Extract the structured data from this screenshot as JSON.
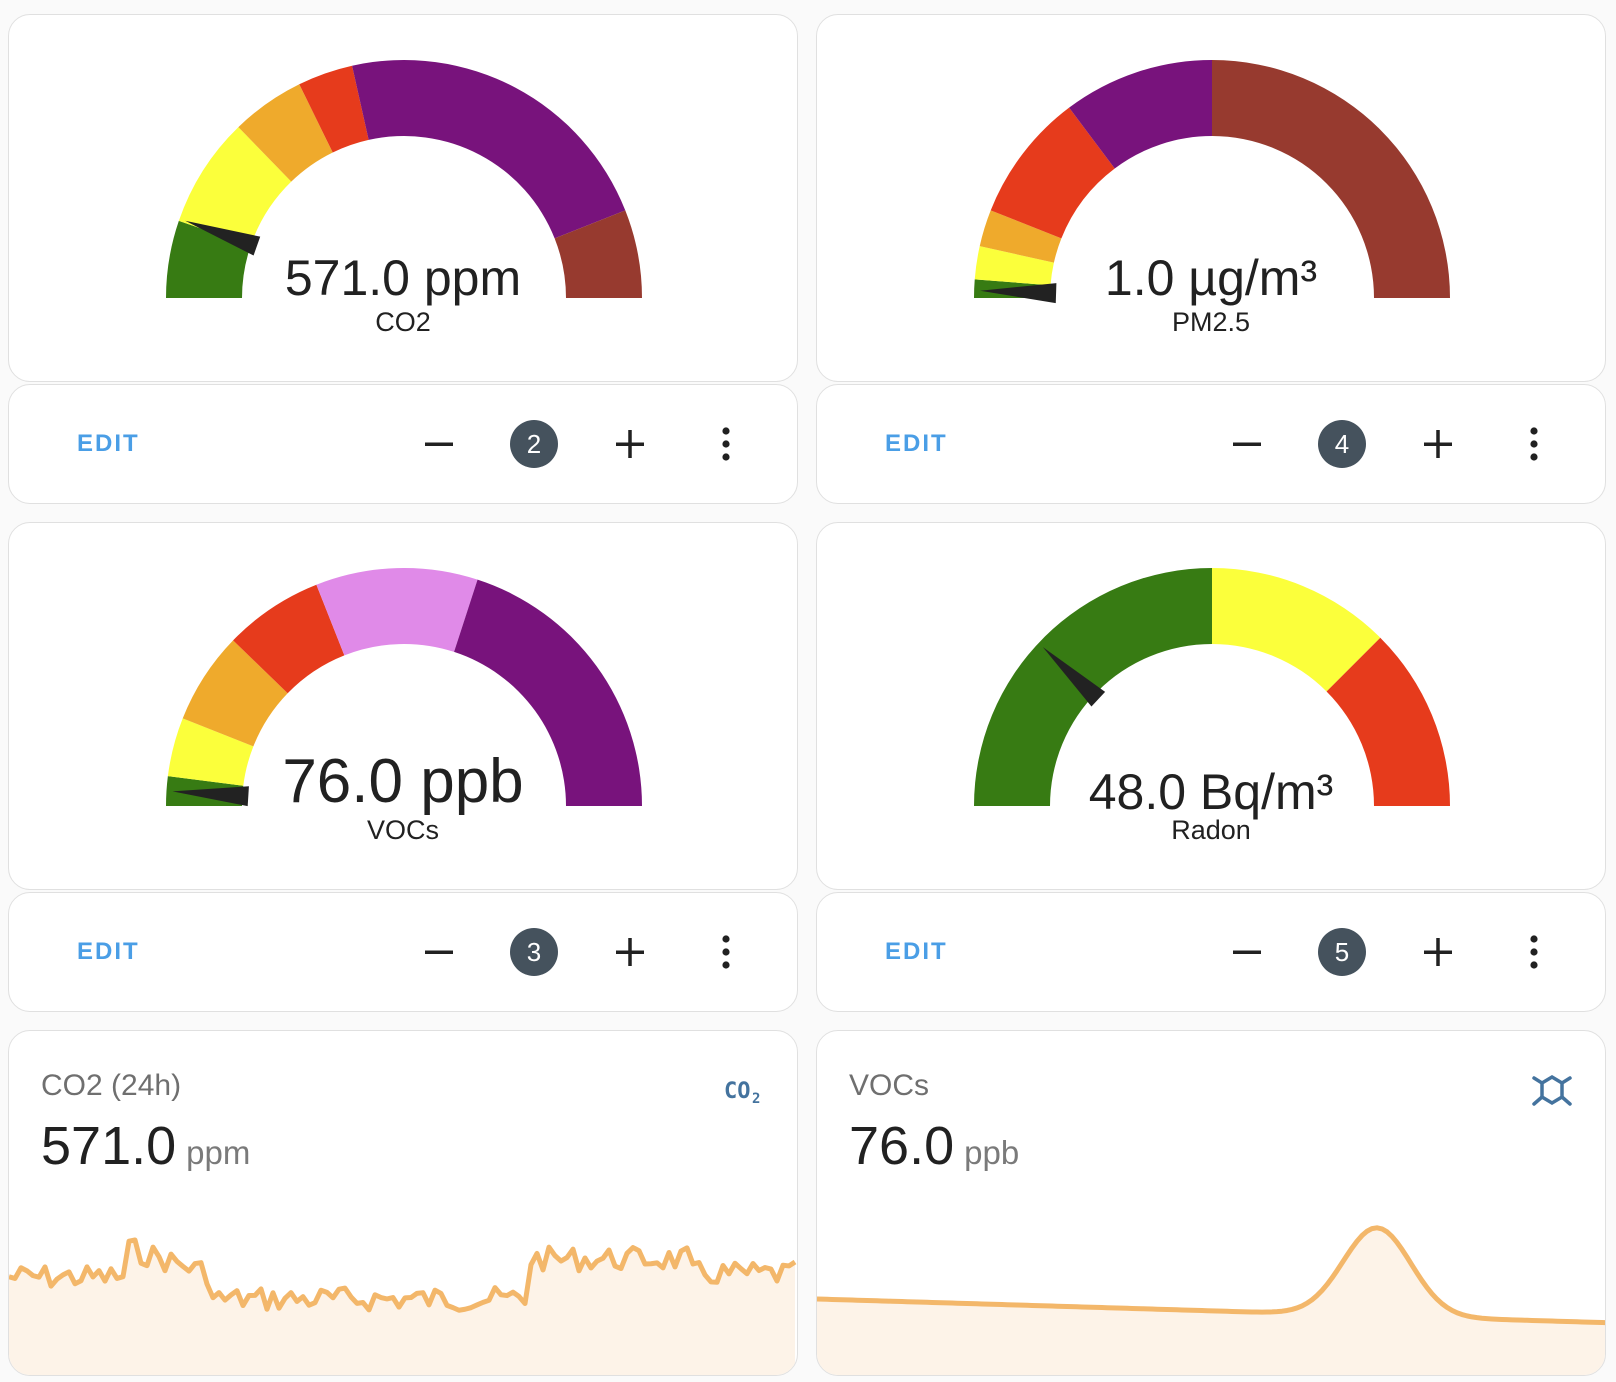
{
  "colors": {
    "green": "#377b13",
    "yellow": "#fbff3b",
    "orange": "#efaa2c",
    "red": "#e63b1c",
    "purple": "#78137c",
    "brown": "#973a2f",
    "pink": "#e08ae8",
    "needle": "#222222",
    "accent": "#4a9ee6",
    "badge": "#45525d",
    "graph_line": "#f3b76a",
    "graph_fill": "#fdf3e8"
  },
  "gauges": [
    {
      "value": "571.0 ppm",
      "name": "CO2",
      "needle_fraction": 0.108,
      "segments": [
        {
          "to": 0.105,
          "color": "green"
        },
        {
          "to": 0.255,
          "color": "yellow"
        },
        {
          "to": 0.355,
          "color": "orange"
        },
        {
          "to": 0.43,
          "color": "red"
        },
        {
          "to": 0.88,
          "color": "purple"
        },
        {
          "to": 1.0,
          "color": "brown"
        }
      ],
      "controls": {
        "edit": "EDIT",
        "minus": "−",
        "count": "2",
        "plus": "+",
        "menu": "more-vertical"
      }
    },
    {
      "value": "1.0 µg/m³",
      "name": "PM2.5",
      "needle_fraction": 0.01,
      "segments": [
        {
          "to": 0.025,
          "color": "green"
        },
        {
          "to": 0.07,
          "color": "yellow"
        },
        {
          "to": 0.12,
          "color": "orange"
        },
        {
          "to": 0.295,
          "color": "red"
        },
        {
          "to": 0.5,
          "color": "purple"
        },
        {
          "to": 1.0,
          "color": "brown"
        }
      ],
      "controls": {
        "edit": "EDIT",
        "minus": "−",
        "count": "4",
        "plus": "+",
        "menu": "more-vertical"
      }
    },
    {
      "value": "76.0 ppb",
      "name": "VOCs",
      "needle_fraction": 0.02,
      "segments": [
        {
          "to": 0.04,
          "color": "green"
        },
        {
          "to": 0.12,
          "color": "yellow"
        },
        {
          "to": 0.245,
          "color": "orange"
        },
        {
          "to": 0.38,
          "color": "red"
        },
        {
          "to": 0.6,
          "color": "pink"
        },
        {
          "to": 1.0,
          "color": "purple"
        }
      ],
      "controls": {
        "edit": "EDIT",
        "minus": "−",
        "count": "3",
        "plus": "+",
        "menu": "more-vertical"
      }
    },
    {
      "value": "48.0 Bq/m³",
      "name": "Radon",
      "needle_fraction": 0.24,
      "segments": [
        {
          "to": 0.5,
          "color": "green"
        },
        {
          "to": 0.75,
          "color": "yellow"
        },
        {
          "to": 1.0,
          "color": "red"
        }
      ],
      "controls": {
        "edit": "EDIT",
        "minus": "−",
        "count": "5",
        "plus": "+",
        "menu": "more-vertical"
      }
    }
  ],
  "sensor_cards": [
    {
      "title": "CO2 (24h)",
      "value": "571.0",
      "unit": "ppm",
      "icon": "co2-icon"
    },
    {
      "title": "VOCs",
      "value": "76.0",
      "unit": "ppb",
      "icon": "molecule-icon"
    }
  ]
}
